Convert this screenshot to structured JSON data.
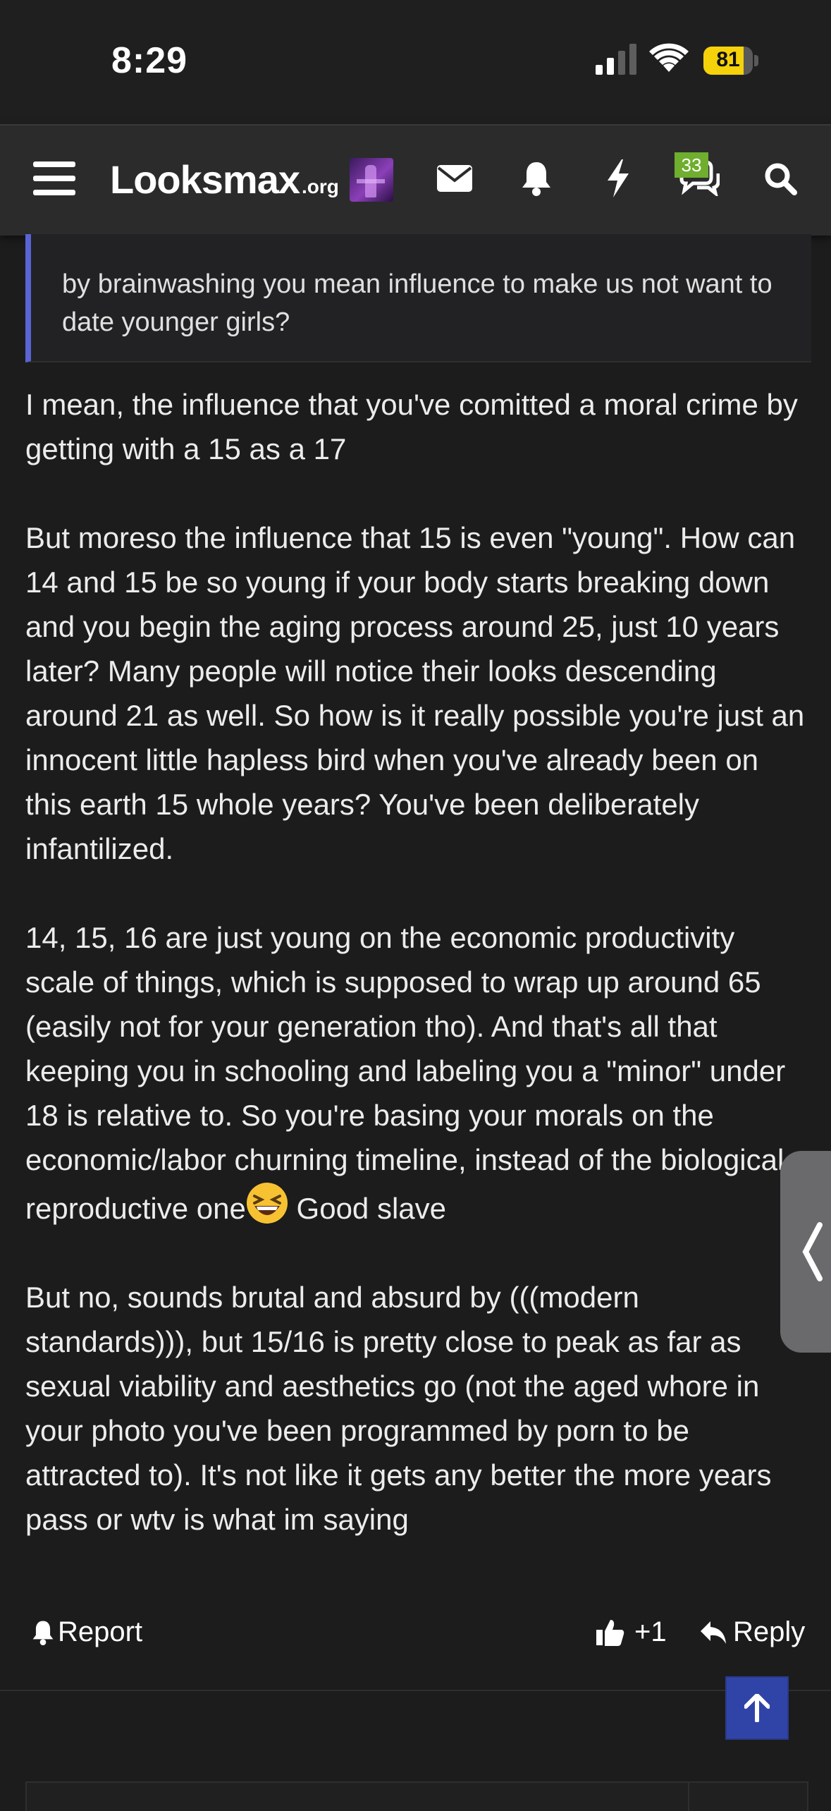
{
  "status_bar": {
    "time": "8:29",
    "battery_percent": "81",
    "battery_level": 0.81,
    "signal_bars": 2,
    "colors": {
      "battery": "#f5d20a"
    }
  },
  "navbar": {
    "logo_main": "Looksmax",
    "logo_suffix": ".org",
    "alerts_badge": "33",
    "icons": [
      "menu-icon",
      "avatar",
      "mail-icon",
      "bell-icon",
      "bolt-icon",
      "chat-icon",
      "search-icon"
    ]
  },
  "quote": {
    "text": "by brainwashing you mean influence to make us not want to date younger girls?"
  },
  "post": {
    "paragraphs": [
      "I mean, the influence that you've comitted a moral crime by getting with a 15 as a 17",
      "But moreso the influence that 15 is even \"young\". How can 14 and 15 be so young if your body starts breaking down and you begin the aging process around 25, just 10 years later? Many people will notice their looks descending around 21 as well. So how is it really possible you're just an innocent little hapless bird when you've already been on this earth 15 whole years? You've been deliberately infantilized.",
      "14, 15, 16 are just young on the economic productivity scale of things, which is supposed to wrap up around 65 (easily not for your generation tho). And that's all that keeping you in schooling and labeling you a \"minor\" under 18 is relative to. So you're basing your morals on the economic/labor churning timeline, instead of the biological reproductive one",
      "Good slave",
      "But no, sounds brutal and absurd by (((modern standards))), but 15/16 is pretty close to peak as far as sexual viability and aesthetics go (not the aged whore in your photo you've been programmed by porn to be attracted to). It's not like it gets any better the more years pass or wtv is what im saying"
    ],
    "emoji": "laughing-face-emoji"
  },
  "actions": {
    "report_label": "Report",
    "like_count": "+1",
    "reply_label": "Reply"
  },
  "colors": {
    "background": "#1c1c1d",
    "navbar": "#2b2b2c",
    "quote_border": "#5a64d4",
    "badge": "#6fae2e",
    "back_to_top": "#3044a8"
  }
}
